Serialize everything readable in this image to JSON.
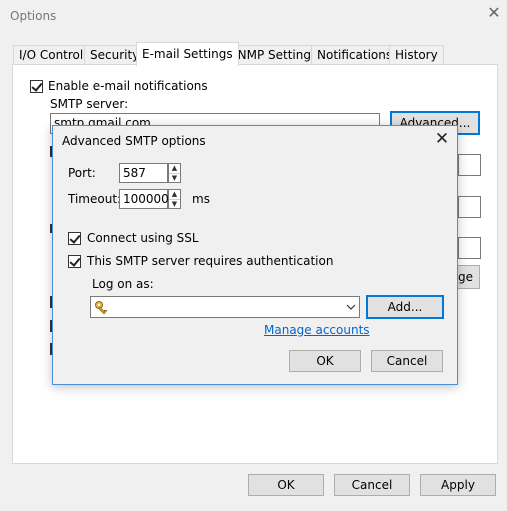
{
  "window": {
    "title": "Options"
  },
  "tabs": [
    {
      "label": "I/O Control"
    },
    {
      "label": "Security"
    },
    {
      "label": "E-mail Settings"
    },
    {
      "label": "SNMP Settings"
    },
    {
      "label": "Notifications"
    },
    {
      "label": "History"
    }
  ],
  "email": {
    "enable_label": "Enable e-mail notifications",
    "enable_checked": true,
    "smtp_label": "SMTP server:",
    "smtp_value": "smtp.gmail.com",
    "advanced_button": "Advanced...",
    "change_button_partial": "ge"
  },
  "dialog": {
    "title": "Advanced SMTP options",
    "port_label": "Port:",
    "port_value": "587",
    "timeout_label": "Timeout:",
    "timeout_value": "100000",
    "timeout_unit": "ms",
    "ssl_label": "Connect using SSL",
    "ssl_checked": true,
    "auth_label": "This SMTP server requires authentication",
    "auth_checked": true,
    "logon_label": "Log on as:",
    "logon_value": "",
    "add_button": "Add...",
    "manage_link": "Manage accounts",
    "ok_button": "OK",
    "cancel_button": "Cancel"
  },
  "footer": {
    "ok": "OK",
    "cancel": "Cancel",
    "apply": "Apply"
  }
}
